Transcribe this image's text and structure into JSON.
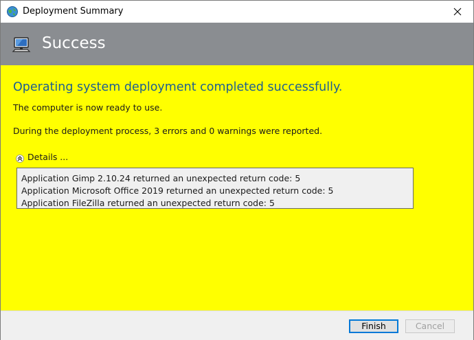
{
  "window": {
    "title": "Deployment Summary",
    "app_icon": "deployment-globe-icon",
    "close_icon": "close-icon"
  },
  "header": {
    "title": "Success",
    "icon": "monitor-icon",
    "background_color": "#8a8d91"
  },
  "content": {
    "background_color": "#ffff00",
    "heading": "Operating system deployment completed successfully.",
    "heading_color": "#1d5f91",
    "ready_text": "The computer is now ready to use.",
    "report_text": "During the deployment process, 3 errors and 0 warnings were reported.",
    "details": {
      "label": "Details ...",
      "toggle_icon": "double-chevron-up-icon",
      "expanded": true,
      "lines": [
        "Application Gimp 2.10.24 returned an unexpected return code: 5",
        "Application Microsoft Office 2019 returned an unexpected return code: 5",
        "Application FileZilla returned an unexpected return code: 5"
      ]
    }
  },
  "footer": {
    "finish_label": "Finish",
    "cancel_label": "Cancel",
    "cancel_enabled": false,
    "accent_color": "#0078d7"
  }
}
